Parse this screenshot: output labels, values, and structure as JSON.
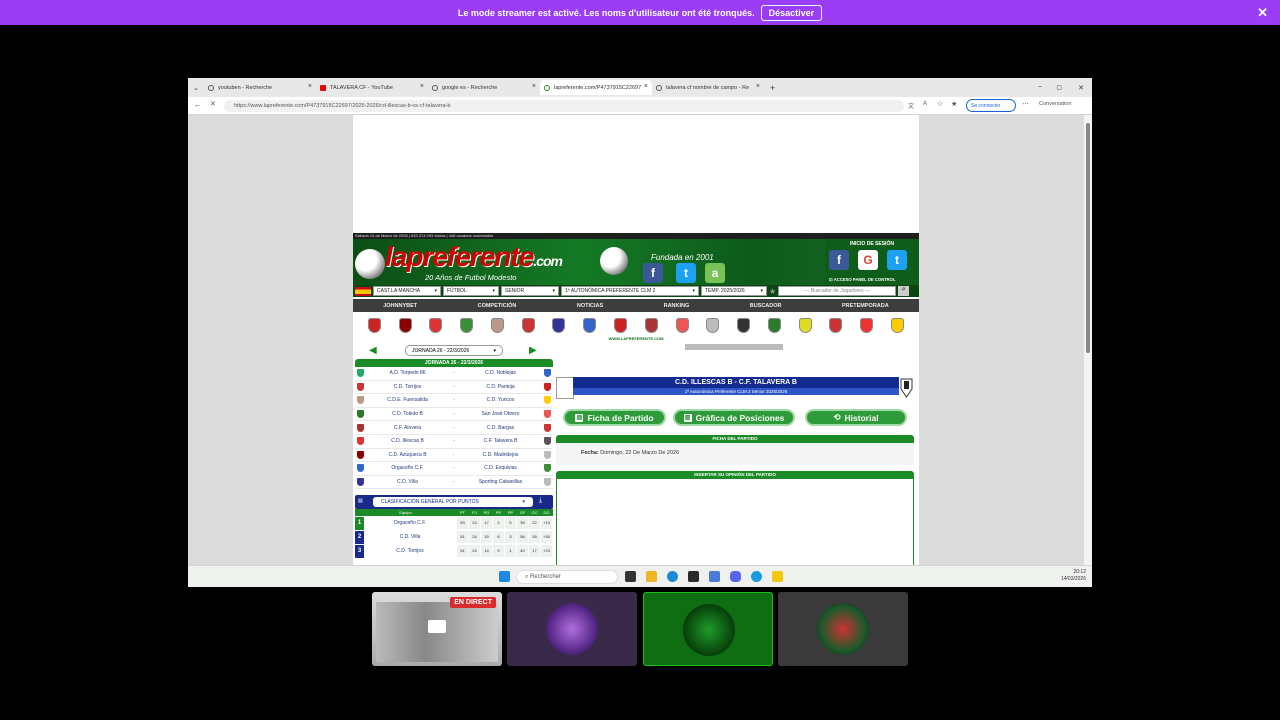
{
  "banner": {
    "text": "Le mode streamer est activé. Les noms d'utilisateur ont été tronqués.",
    "button": "Désactiver"
  },
  "browser": {
    "tabs": [
      {
        "label": "youtuben - Recherche"
      },
      {
        "label": "TALAVERA CF - YouTube"
      },
      {
        "label": "google es - Recherche"
      },
      {
        "label": "lapreferente.com/P4737915C22697"
      },
      {
        "label": "talavera cf nombre de campo - Re"
      }
    ],
    "url": "https://www.lapreferente.com/P4737915C22697/2025-2026/cd-illescas-b-vs-cf-talavera-b",
    "signin": "Se connecter",
    "conversation": "Conversation"
  },
  "site": {
    "datebar": "Sábado 14 de Marzo de 2026 | 833.374.093 visitas | 448 usuarios conectados",
    "logo": "lapreferente",
    "logo_com": ".com",
    "tagline": "20 Años de Futbol Modesto",
    "fundada": "Fundada en 2001",
    "login_title": "INICIO DE SESIÓN",
    "login_check": "ACCESO PANEL DE CONTROL",
    "selects": [
      "CAST.LA MANCHA",
      "FÚTBOL",
      "SENIOR",
      "1ª AUTONÓMICA PREFERENTE CLM 2",
      "TEMP. 2025/2026"
    ],
    "player_search": "--- Buscador de Jugadores ---",
    "menu": [
      "JOHNNYBET",
      "COMPETICIÓN",
      "NOTICIAS",
      "RANKING",
      "BUSCADOR",
      "PRETEMPORADA"
    ],
    "www": "WWW.LAPREFERENTE.COM",
    "jornada_select": "JORNADA 26 - 22/3/2026",
    "jornada_head": "JORNADA 26 - 22/3/2026",
    "matches": [
      {
        "home": "A.D. Torpedo 86",
        "away": "C.D. Noblejas"
      },
      {
        "home": "C.D. Torrijos",
        "away": "C.D. Pantoja"
      },
      {
        "home": "C.D.E. Fuensalida",
        "away": "C.D. Yuncos"
      },
      {
        "home": "C.D. Toledo B",
        "away": "San José Obrero"
      },
      {
        "home": "C.F. Alovera",
        "away": "C.D. Bargas"
      },
      {
        "home": "C.D. Illescas B",
        "away": "C.F. Talavera B"
      },
      {
        "home": "C.D. Azuqueca B",
        "away": "C.D. Madridejos"
      },
      {
        "home": "Orgaceño C.F.",
        "away": "C.D. Esquivias"
      },
      {
        "home": "C.D. Villa",
        "away": "Sporting Cabanillas"
      }
    ],
    "clasif_select": "CLASIFICACIÓN GENERAL POR PUNTOS",
    "standings_head": {
      "team": "Equipo",
      "cols": [
        "PT",
        "PJ",
        "PG",
        "PE",
        "PP",
        "GF",
        "GC",
        "DG"
      ]
    },
    "standings": [
      {
        "pos": "1",
        "team": "Orgaceño C.F.",
        "vals": [
          "53",
          "24",
          "17",
          "2",
          "5",
          "39",
          "22",
          "+13"
        ],
        "color": "#1b8b28"
      },
      {
        "pos": "2",
        "team": "C.D. Villa",
        "vals": [
          "51",
          "24",
          "15",
          "6",
          "3",
          "56",
          "26",
          "+30"
        ],
        "color": "#1a2a8a"
      },
      {
        "pos": "3",
        "team": "C.D. Torrijos",
        "vals": [
          "51",
          "24",
          "14",
          "9",
          "1",
          "40",
          "17",
          "+23"
        ],
        "color": "#1a2a8a"
      }
    ],
    "match_title": "C.D. ILLESCAS B - C.F. TALAVERA B",
    "match_sub": "1ª Autonómica Preferente CLM 2 Senior 2025/2026",
    "btn_ficha": "Ficha de Partido",
    "btn_grafica": "Gráfica de Posiciones",
    "btn_historial": "Historial",
    "ficha_head": "FICHA DEL PARTIDO",
    "fecha_label": "Fecha:",
    "fecha_value": "Domingo, 22 De Marzo De 2026",
    "opinion_head": "INSERTAR SU OPINIÓN DEL PARTIDO"
  },
  "taskbar": {
    "search": "Rechercher",
    "time": "20:12",
    "date": "14/03/2026"
  },
  "tiles": {
    "live": "EN DIRECT"
  },
  "colors": {
    "banner": "#9b3df5",
    "green": "#1b8b28",
    "navy": "#132a8e"
  }
}
